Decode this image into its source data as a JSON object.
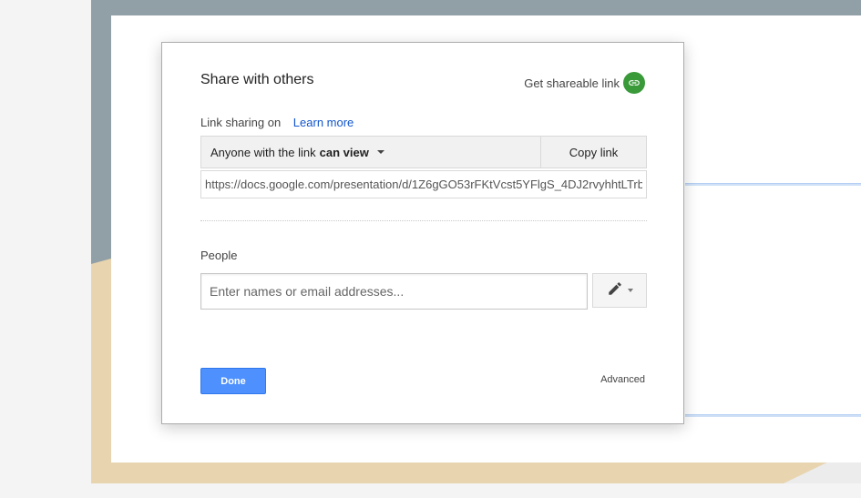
{
  "dialog": {
    "title": "Share with others",
    "get_link_label": "Get shareable link",
    "link_icon": "link-icon",
    "sharing_status": "Link sharing on",
    "learn_more": "Learn more",
    "access_prefix": "Anyone with the link",
    "access_role": "can view",
    "copy_link": "Copy link",
    "url": "https://docs.google.com/presentation/d/1Z6gGO53rFKtVcst5YFlgS_4DJ2rvyhhtLTrb",
    "people_label": "People",
    "people_placeholder": "Enter names or email addresses...",
    "permission_icon": "pencil-icon",
    "done_label": "Done",
    "advanced_label": "Advanced"
  },
  "colors": {
    "primary_button": "#4d90fe",
    "link": "#1155cc",
    "share_link_icon_bg": "#3a9a3a"
  }
}
